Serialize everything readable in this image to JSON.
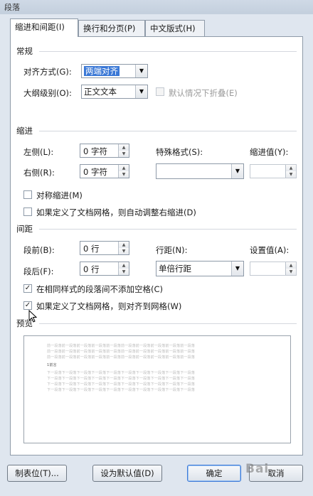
{
  "window": {
    "title": "段落"
  },
  "tabs": [
    {
      "label": "缩进和间距(I)",
      "active": true
    },
    {
      "label": "换行和分页(P)",
      "active": false
    },
    {
      "label": "中文版式(H)",
      "active": false
    }
  ],
  "general": {
    "section_label": "常规",
    "alignment_label": "对齐方式(G):",
    "alignment_value": "两端对齐",
    "outline_label": "大纲级别(O):",
    "outline_value": "正文文本",
    "collapse_label": "默认情况下折叠(E)"
  },
  "indent": {
    "section_label": "缩进",
    "left_label": "左侧(L):",
    "left_value": "0 字符",
    "right_label": "右侧(R):",
    "right_value": "0 字符",
    "special_label": "特殊格式(S):",
    "special_value": "",
    "indent_by_label": "缩进值(Y):",
    "mirror_label": "对称缩进(M)",
    "grid_adjust_label": "如果定义了文档网格，则自动调整右缩进(D)"
  },
  "spacing": {
    "section_label": "间距",
    "before_label": "段前(B):",
    "before_value": "0 行",
    "after_label": "段后(F):",
    "after_value": "0 行",
    "line_label": "行距(N):",
    "line_value": "单倍行距",
    "at_label": "设置值(A):",
    "no_space_label": "在相同样式的段落间不添加空格(C)",
    "snap_grid_label": "如果定义了文档网格，则对齐到网格(W)"
  },
  "preview": {
    "section_label": "预览",
    "prev_text": "前一段落前一段落前一段落前一段落前一段落前一段落前一段落前一段落前一段落前一段落",
    "main_text": "1前言",
    "next_text": "下一段落下一段落下一段落下一段落下一段落下一段落下一段落下一段落下一段落下一段落"
  },
  "buttons": {
    "tabs": "制表位(T)...",
    "set_default": "设为默认值(D)",
    "ok": "确定",
    "cancel": "取消"
  },
  "watermark": "Bai"
}
